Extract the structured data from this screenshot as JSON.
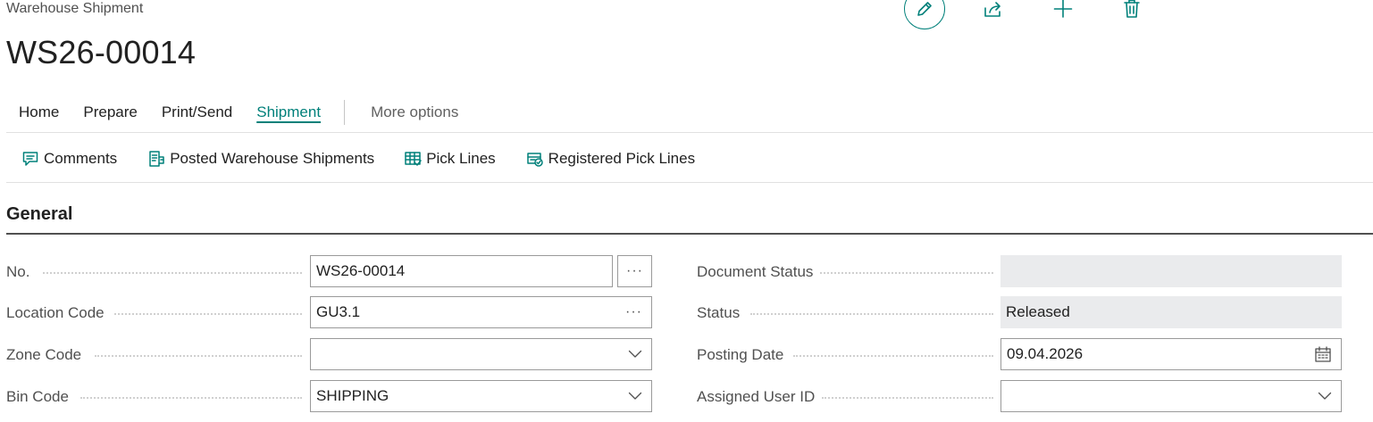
{
  "page": {
    "caption": "Warehouse Shipment",
    "title": "WS26-00014"
  },
  "toolbar": {
    "edit_icon": "pencil-icon",
    "share_icon": "share-icon",
    "new_icon": "plus-icon",
    "delete_icon": "trash-icon",
    "accent_color": "#00807a"
  },
  "menu": {
    "items": [
      "Home",
      "Prepare",
      "Print/Send",
      "Shipment"
    ],
    "active": "Shipment",
    "more": "More options"
  },
  "actions": [
    {
      "label": "Comments",
      "icon": "comment-icon"
    },
    {
      "label": "Posted Warehouse Shipments",
      "icon": "posted-shipments-icon"
    },
    {
      "label": "Pick Lines",
      "icon": "pick-lines-icon"
    },
    {
      "label": "Registered Pick Lines",
      "icon": "registered-pick-lines-icon"
    }
  ],
  "general": {
    "title": "General",
    "left": [
      {
        "label": "No.",
        "value": "WS26-00014"
      },
      {
        "label": "Location Code",
        "value": "GU3.1"
      },
      {
        "label": "Zone Code",
        "value": ""
      },
      {
        "label": "Bin Code",
        "value": "SHIPPING"
      }
    ],
    "right": [
      {
        "label": "Document Status",
        "value": ""
      },
      {
        "label": "Status",
        "value": "Released"
      },
      {
        "label": "Posting Date",
        "value": "09.04.2026"
      },
      {
        "label": "Assigned User ID",
        "value": ""
      }
    ],
    "ellipsis": "···"
  }
}
